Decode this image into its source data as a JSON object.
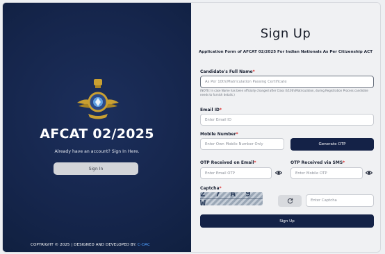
{
  "left_panel": {
    "title": "AFCAT 02/2025",
    "subtitle": "Already have an account? Sign In Here.",
    "signin_label": "Sign In",
    "copyright_prefix": "COPYRIGHT © 2025 | DESIGNED AND DEVELOPED BY:",
    "copyright_brand": "C-DAC"
  },
  "form": {
    "title": "Sign Up",
    "subtitle": "Application Form of AFCAT 02/2025 For Indian Nationals As Per Citizenship ACT",
    "full_name": {
      "label": "Candidate's Full Name",
      "placeholder": "As Per 10th/Matriculation Passing Certificate",
      "note": "(NOTE: In case Name has been officially changed after Class X/10th(Matriculation, during Registration Process candidate needs to furnish details.)"
    },
    "email": {
      "label": "Email ID",
      "placeholder": "Enter Email ID"
    },
    "mobile": {
      "label": "Mobile Number",
      "placeholder": "Enter Own Mobile Number Only"
    },
    "generate_otp_label": "Generate OTP",
    "otp_email": {
      "label": "OTP Received on Email",
      "placeholder": "Enter Email OTP"
    },
    "otp_sms": {
      "label": "OTP Received via SMS",
      "placeholder": "Enter Mobile OTP"
    },
    "captcha": {
      "label": "Captcha",
      "image_text": "2 7 A 9 W",
      "placeholder": "Enter Captcha"
    },
    "signup_label": "Sign Up",
    "required_mark": "*"
  },
  "colors": {
    "left_bg": "#15254b",
    "primary_button": "#142247",
    "required": "#d22222",
    "brand_accent": "#4fa0ff"
  },
  "icons": {
    "emblem": "indian-air-force-emblem",
    "eye": "eye-icon",
    "refresh": "refresh-icon"
  }
}
